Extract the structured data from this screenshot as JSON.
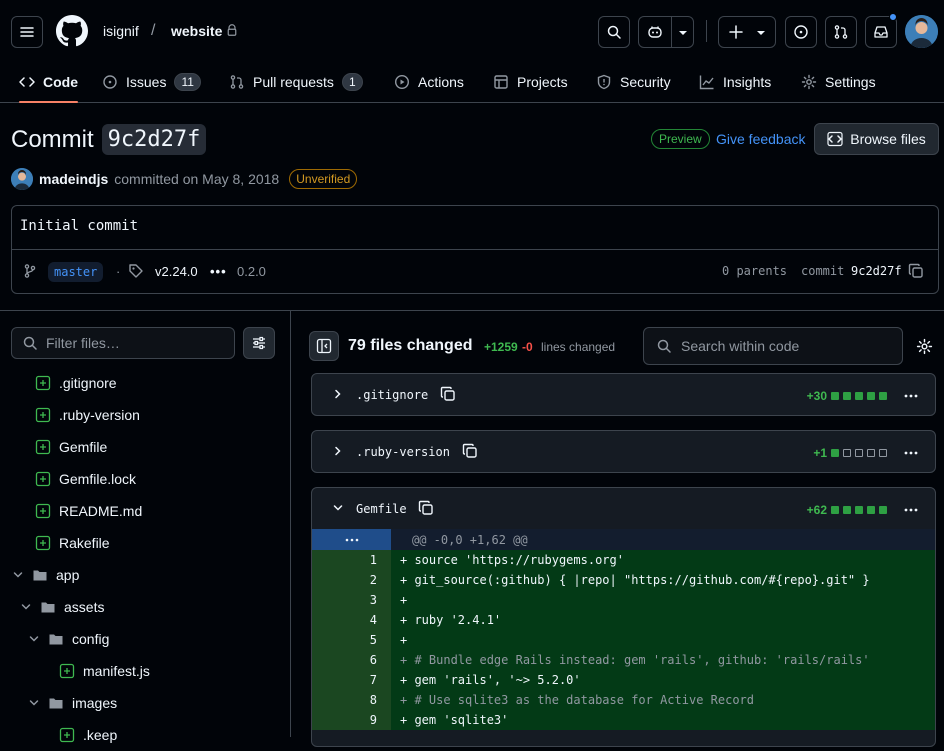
{
  "header": {
    "owner": "isignif",
    "separator": "/",
    "repo": "website"
  },
  "repo_nav": {
    "tabs": [
      {
        "label": "Code",
        "icon": "code-icon",
        "active": true
      },
      {
        "label": "Issues",
        "icon": "issue-opened-icon",
        "count": "11"
      },
      {
        "label": "Pull requests",
        "icon": "pull-request-icon",
        "count": "1"
      },
      {
        "label": "Actions",
        "icon": "play-icon"
      },
      {
        "label": "Projects",
        "icon": "table-icon"
      },
      {
        "label": "Security",
        "icon": "shield-icon"
      },
      {
        "label": "Insights",
        "icon": "graph-icon"
      },
      {
        "label": "Settings",
        "icon": "gear-icon"
      }
    ]
  },
  "commit": {
    "title_prefix": "Commit",
    "sha_short": "9c2d27f",
    "preview_badge": "Preview",
    "give_feedback": "Give feedback",
    "browse_files": "Browse files",
    "author": "madeindjs",
    "committed_text": "committed on May 8, 2018",
    "verification": "Unverified",
    "message": "Initial commit",
    "branch": "master",
    "dot": "·",
    "tag": "v2.24.0",
    "more": "•••",
    "extra_tag": "0.2.0",
    "parents": "0 parents",
    "commit_label": "commit",
    "commit_sha": "9c2d27f"
  },
  "file_tree": {
    "filter_placeholder": "Filter files…",
    "items": [
      {
        "name": ".gitignore",
        "type": "file"
      },
      {
        "name": ".ruby-version",
        "type": "file"
      },
      {
        "name": "Gemfile",
        "type": "file"
      },
      {
        "name": "Gemfile.lock",
        "type": "file"
      },
      {
        "name": "README.md",
        "type": "file"
      },
      {
        "name": "Rakefile",
        "type": "file"
      },
      {
        "name": "app",
        "type": "folder"
      },
      {
        "name": "assets",
        "type": "folder"
      },
      {
        "name": "config",
        "type": "folder"
      },
      {
        "name": "manifest.js",
        "type": "file"
      },
      {
        "name": "images",
        "type": "folder"
      },
      {
        "name": ".keep",
        "type": "file"
      }
    ]
  },
  "diff": {
    "files_changed": "79 files changed",
    "additions": "+1259",
    "deletions": "-0",
    "lines_changed": "lines changed",
    "search_placeholder": "Search within code",
    "files": [
      {
        "name": ".gitignore",
        "stat": "+30",
        "bar": [
          "g",
          "g",
          "g",
          "g",
          "g"
        ],
        "expanded": false
      },
      {
        "name": ".ruby-version",
        "stat": "+1",
        "bar": [
          "g",
          "e",
          "e",
          "e",
          "e"
        ],
        "expanded": false
      },
      {
        "name": "Gemfile",
        "stat": "+62",
        "bar": [
          "g",
          "g",
          "g",
          "g",
          "g"
        ],
        "expanded": true
      }
    ],
    "hunk_header": "@@ -0,0 +1,62 @@",
    "lines": [
      {
        "num": "1",
        "text": "+ source 'https://rubygems.org'"
      },
      {
        "num": "2",
        "text": "+ git_source(:github) { |repo| \"https://github.com/#{repo}.git\" }"
      },
      {
        "num": "3",
        "text": "+"
      },
      {
        "num": "4",
        "text": "+ ruby '2.4.1'"
      },
      {
        "num": "5",
        "text": "+"
      },
      {
        "num": "6",
        "text": "+ # Bundle edge Rails instead: gem 'rails', github: 'rails/rails'"
      },
      {
        "num": "7",
        "text": "+ gem 'rails', '~> 5.2.0'"
      },
      {
        "num": "8",
        "text": "+ # Use sqlite3 as the database for Active Record"
      },
      {
        "num": "9",
        "text": "+ gem 'sqlite3'"
      }
    ]
  },
  "colors": {
    "accent_blue": "#4493f8",
    "addition_green": "#3fb950",
    "deletion_red": "#f85149",
    "active_tab_underline": "#f78166"
  }
}
